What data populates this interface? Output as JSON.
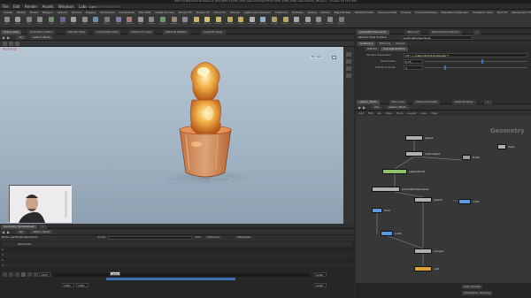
{
  "app": {
    "title": "[KIT1.0] MetaTutorial Network_Files/[KIT1] 1008_1000_Vellumfluids/[VTU]1.0000_1008_1000_Vellumfluids_08.hipnc - Houdini FX 17.0.352",
    "menu": [
      "File",
      "Edit",
      "Render",
      "Assets",
      "Windows",
      "Labs",
      "Help"
    ],
    "desktop": "Light"
  },
  "shelf": {
    "tabs": [
      "Create",
      "Modify",
      "Model",
      "Polygon",
      "Deform",
      "Texture",
      "Rigging",
      "Characters",
      "Constraints",
      "Hair Utils",
      "Guide Process",
      "Terrain FX",
      "Simple FX",
      "Cloud FX",
      "Volume",
      "Lights and Cameras",
      "Collisions",
      "Particles",
      "Grains",
      "Vellum",
      "Rigid Bodies",
      "Particle Fluids",
      "Viscous Fluids",
      "Oceans",
      "Fluid Containers",
      "Populate Containers",
      "Container Tools",
      "Pyro FX",
      "Sparse Pyro FX",
      "FEM",
      "Wires",
      "Crowds",
      "Drive Simulation"
    ],
    "tools": [
      {
        "label": "Box",
        "color": "#8a8a8a"
      },
      {
        "label": "Sphere",
        "color": "#9a9a9a"
      },
      {
        "label": "Tube",
        "color": "#7f7f7f"
      },
      {
        "label": "Torus",
        "color": "#8c8c8c"
      },
      {
        "label": "Grid",
        "color": "#6e8f6e"
      },
      {
        "label": "Null",
        "color": "#6a6a9a"
      },
      {
        "label": "Line",
        "color": "#a0a0a0"
      },
      {
        "label": "Circle",
        "color": "#8f8f8f"
      },
      {
        "label": "Curve",
        "color": "#6f8fa8"
      },
      {
        "label": "Draw Curve",
        "color": "#7a7a7a"
      },
      {
        "label": "Path",
        "color": "#7a7aa8"
      },
      {
        "label": "Spray Paint",
        "color": "#a87a7a"
      },
      {
        "label": "Font",
        "color": "#9a9a9a"
      },
      {
        "label": "Platonic Solids",
        "color": "#8a8a8a"
      },
      {
        "label": "L-System",
        "color": "#6f9a6f"
      },
      {
        "label": "Metaball",
        "color": "#9a8a6f"
      },
      {
        "label": "File",
        "color": "#8a8a8a"
      },
      {
        "label": "Spot Light",
        "color": "#c8b46a"
      },
      {
        "label": "Area Light",
        "color": "#d0c070"
      },
      {
        "label": "Geometry Light",
        "color": "#c8b46a"
      },
      {
        "label": "Volume Light",
        "color": "#b8a860"
      },
      {
        "label": "Distant Light",
        "color": "#c0b060"
      },
      {
        "label": "Environment Light",
        "color": "#b0b0b0"
      },
      {
        "label": "Sky Light",
        "color": "#8fb0d0"
      },
      {
        "label": "GI Light",
        "color": "#b0a070"
      },
      {
        "label": "Caustic Light",
        "color": "#b8a868"
      },
      {
        "label": "Portal Light",
        "color": "#a8a8a8"
      },
      {
        "label": "Ambient Light",
        "color": "#a0a0a0"
      },
      {
        "label": "Camera",
        "color": "#909090"
      },
      {
        "label": "VR Camera",
        "color": "#888"
      },
      {
        "label": "Switcher",
        "color": "#7a7a7a"
      }
    ]
  },
  "left_tabs": [
    "Scene View",
    "Animation Editor",
    "Render View",
    "Composite View",
    "Motion FX View",
    "Material Palette",
    "Asset Browser"
  ],
  "left_path": [
    "obj",
    "vellum_fluids"
  ],
  "viewport": {
    "title": "Material",
    "camera_label": "No cam"
  },
  "spreadsheet": {
    "tabs": [
      "Geometry Spreadsheet",
      "+"
    ],
    "path": [
      "obj",
      "vellum_fluids"
    ],
    "node_label": "Node: particlefluidsurface1",
    "group_label": "Group:",
    "view_label": "View",
    "intrinsics_label": "Intrinsics",
    "attributes_label": "Attributes",
    "col_header": "Point Num",
    "rows": [
      "0",
      "1",
      "2",
      "3"
    ]
  },
  "timeline": {
    "start": "1001",
    "start2": "1001",
    "current": "1053",
    "end": "1240",
    "end2": "1240",
    "frame_label": "1053"
  },
  "right_tabs": [
    "particlefluidsurface1",
    "Take List",
    "Performance Monitor",
    "+"
  ],
  "params": {
    "node_type": "Particle Fluid Surface",
    "node_name": "particlefluidsurface1",
    "tabs": [
      "Surfacing",
      "Filtering",
      "Output"
    ],
    "subtabs": [
      "Method",
      "Average Position"
    ],
    "particle_sep_label": "Particle Separation",
    "particle_sep_value": "ch(\"../../vellumfluid1/gradscale\")",
    "voxel_label": "Voxel Scale",
    "voxel_value": "0.75",
    "influence_label": "Influence Scale",
    "influence_value": "3"
  },
  "network": {
    "tabs": [
      "vellum_fluids",
      "Tree View",
      "Material Palette",
      "Asset Browser",
      "+"
    ],
    "path": [
      "obj",
      "vellum_fluids"
    ],
    "menu": [
      "Add",
      "Edit",
      "Go",
      "View",
      "Tools",
      "Layout",
      "Labs",
      "Help"
    ],
    "context_label": "Geometry",
    "nodes": [
      {
        "name": "glass1",
        "color": "#b0b0b0"
      },
      {
        "name": "matchsize1",
        "color": "#b0b0b0"
      },
      {
        "name": "font1",
        "color": "#9a9a9a"
      },
      {
        "name": "vellumfluid1",
        "color": "#8fc06a"
      },
      {
        "name": "particlefluidsurface1",
        "color": "#b0b0b0"
      },
      {
        "name": "glass2",
        "color": "#b0b0b0"
      },
      {
        "name": "fluid",
        "color": "#5a9adf"
      },
      {
        "name": "null1",
        "color": "#5a9adf"
      },
      {
        "name": "null2",
        "color": "#5a9adf"
      },
      {
        "name": "merge1",
        "color": "#b0b0b0"
      },
      {
        "name": "dop1",
        "color": "#b0b0b0"
      },
      {
        "name": "out1",
        "color": "#e0a040"
      }
    ]
  },
  "bottom_right": {
    "auto_update": "Auto Update",
    "simulation": "Simulation: Running"
  },
  "colors": {
    "accent": "#e05050",
    "timeline_blue": "#3f6fb5",
    "sky": "#a9bccb"
  }
}
